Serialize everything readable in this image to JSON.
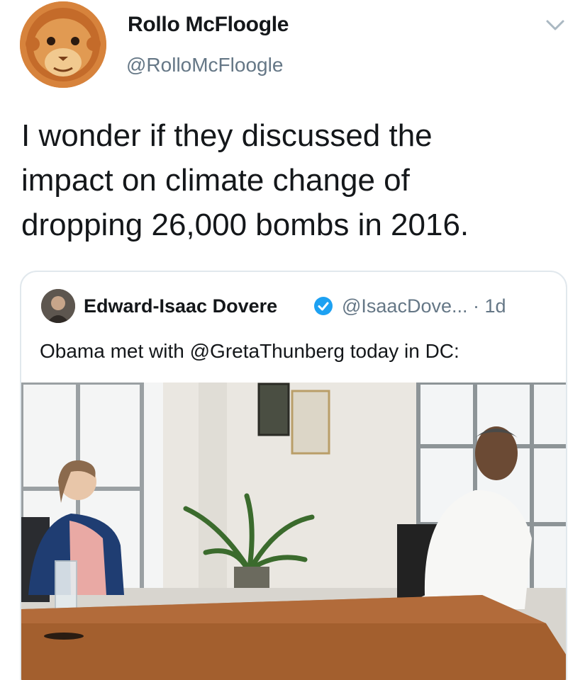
{
  "tweet": {
    "author_name": "Rollo McFloogle",
    "author_handle": "@RolloMcFloogle",
    "text": "I wonder if they discussed the\nimpact on climate change of\ndropping 26,000 bombs in 2016.",
    "avatar_icon": "monkey-face-icon",
    "menu_icon": "chevron-down-icon"
  },
  "quoted_tweet": {
    "author_name": "Edward-Isaac Dovere",
    "verified_icon": "verified-badge-icon",
    "author_handle": "@IsaacDove...",
    "separator": "·",
    "time": "1d",
    "text": "Obama met with @GretaThunberg today in DC:"
  },
  "colors": {
    "text": "#14171a",
    "secondary": "#657786",
    "verified": "#1da1f2",
    "border": "#e1e8ed"
  }
}
